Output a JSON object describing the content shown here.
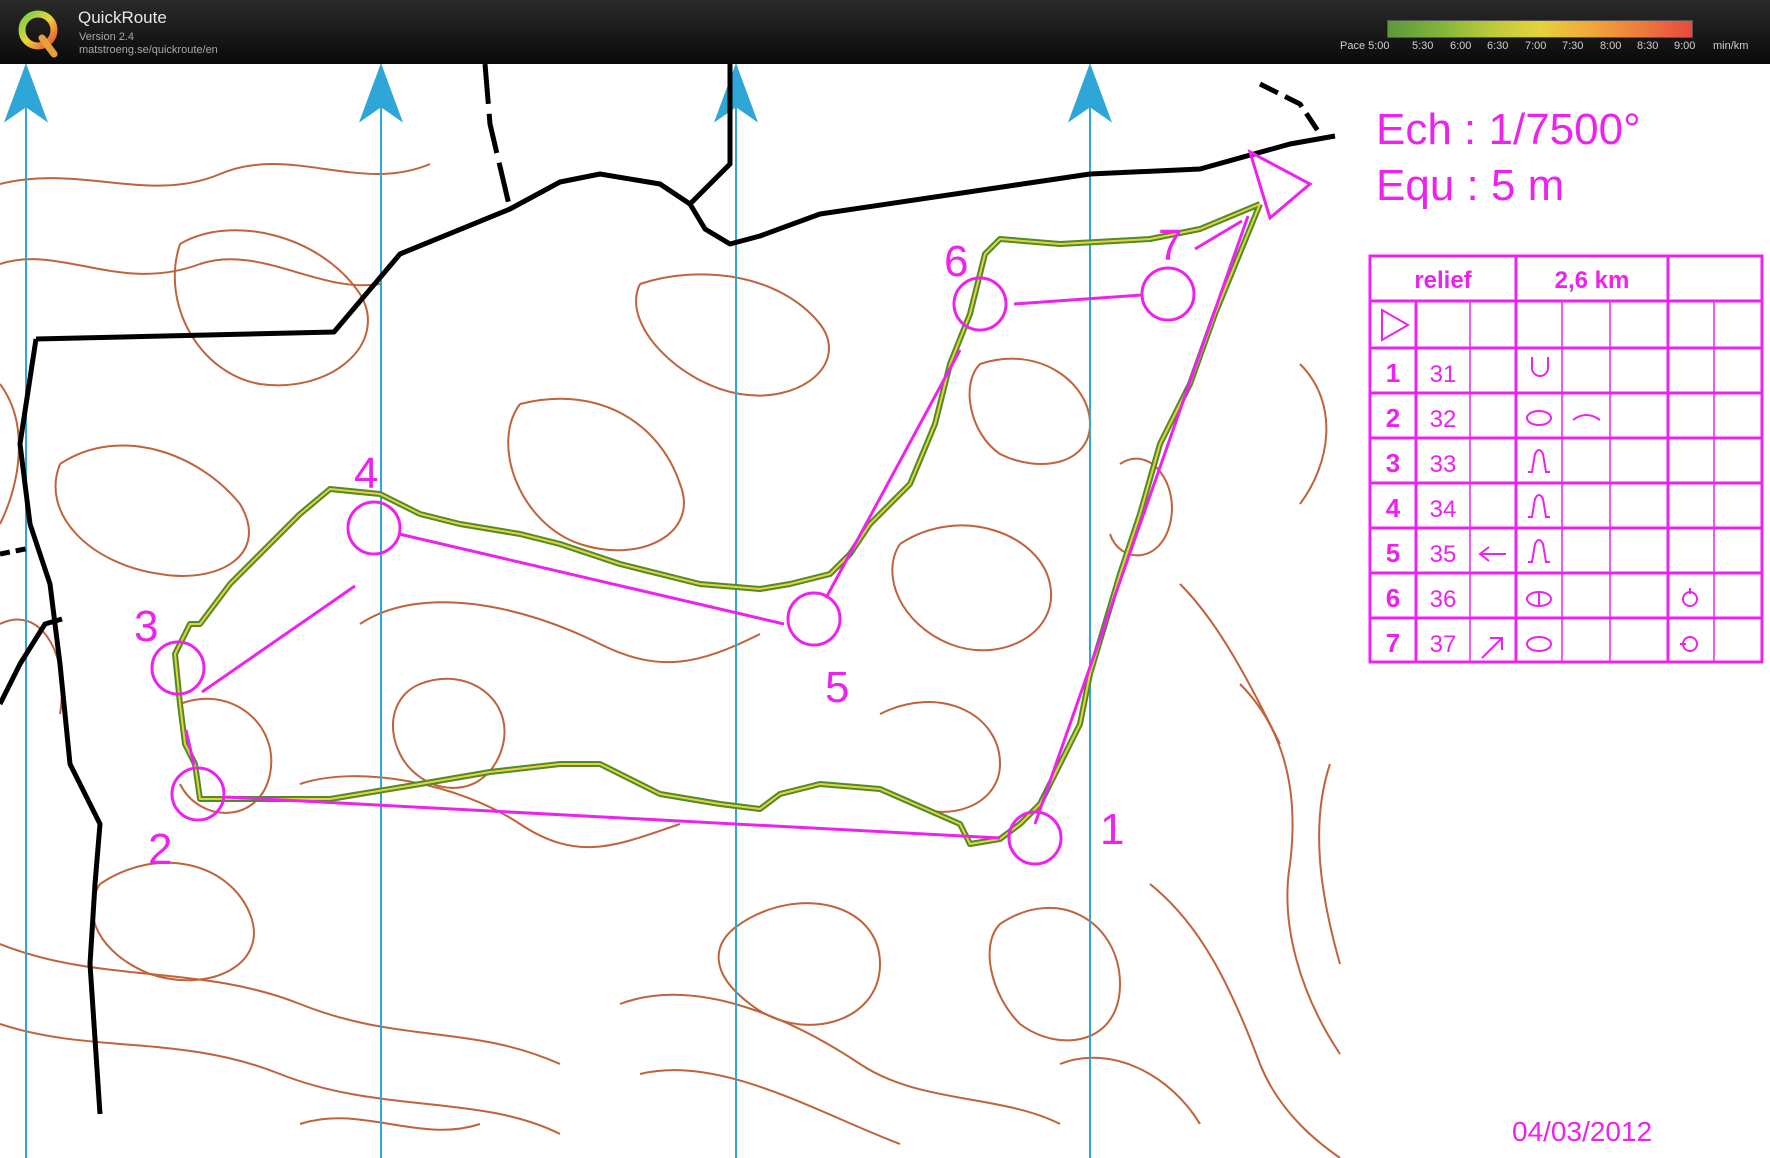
{
  "header": {
    "app_name": "QuickRoute",
    "version": "Version 2.4",
    "url": "matstroeng.se/quickroute/en",
    "logo_letter": "Q",
    "pace_legend": {
      "labels": [
        "Pace 5:00",
        "5:30",
        "6:00",
        "6:30",
        "7:00",
        "7:30",
        "8:00",
        "8:30",
        "9:00",
        "min/km"
      ],
      "colors": [
        "#5a9a3c",
        "#7fb33d",
        "#b9c93a",
        "#e6d23b",
        "#f0a83a",
        "#ee7a3d",
        "#e8483f"
      ]
    }
  },
  "map": {
    "scale": "Ech : 1/7500°",
    "contour_interval": "Equ : 5 m",
    "date": "04/03/2012",
    "controls": [
      {
        "label": "1",
        "number": "31"
      },
      {
        "label": "2",
        "number": "32"
      },
      {
        "label": "3",
        "number": "33"
      },
      {
        "label": "4",
        "number": "34"
      },
      {
        "label": "5",
        "number": "35"
      },
      {
        "label": "6",
        "number": "36"
      },
      {
        "label": "7",
        "number": "37"
      }
    ],
    "description_sheet": {
      "title": "relief",
      "distance": "2,6 km"
    },
    "colors": {
      "course": "#ee22ee",
      "contour": "#c0623a",
      "north_line": "#2ea6d8",
      "road": "#000000"
    }
  }
}
